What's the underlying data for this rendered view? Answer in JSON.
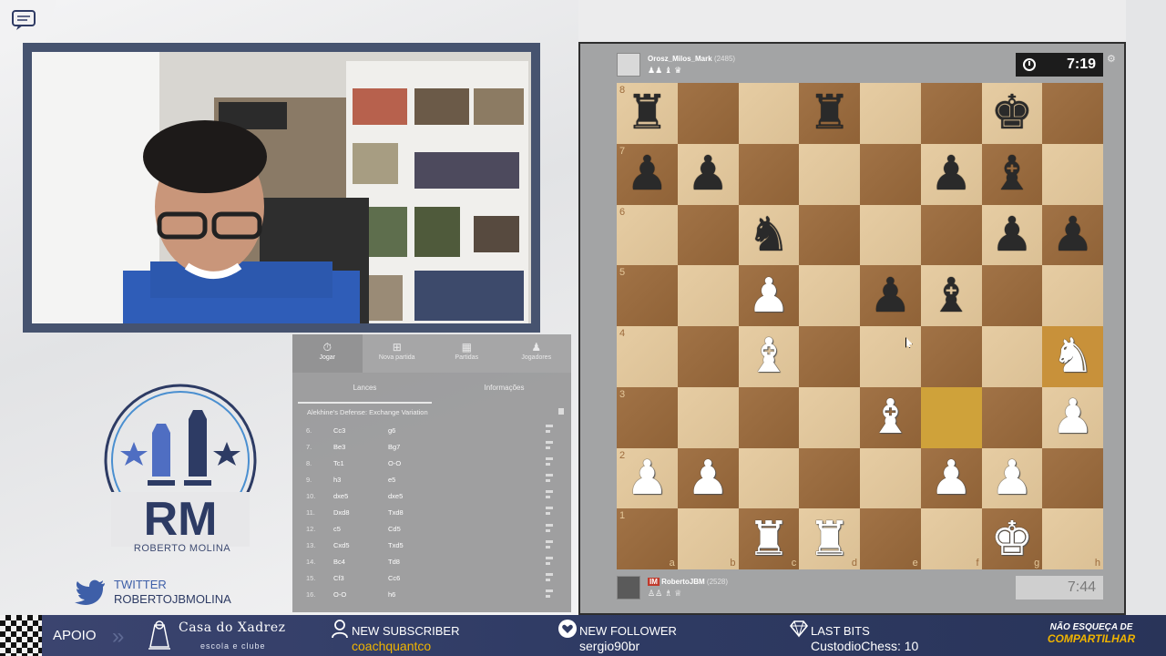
{
  "stream": {
    "twitter_label": "TWITTER",
    "twitter_handle": "ROBERTOJBMOLINA",
    "logo_letters": "RM",
    "logo_name": "ROBERTO MOLINA"
  },
  "lichess_panel": {
    "tabs": [
      {
        "label": "Jogar",
        "icon": "timer-icon",
        "active": true
      },
      {
        "label": "Nova partida",
        "icon": "plus-icon",
        "active": false
      },
      {
        "label": "Partidas",
        "icon": "grid-icon",
        "active": false
      },
      {
        "label": "Jogadores",
        "icon": "players-icon",
        "active": false
      }
    ],
    "subtabs": [
      {
        "label": "Lances",
        "active": true
      },
      {
        "label": "Informações",
        "active": false
      }
    ],
    "opening": "Alekhine's Defense: Exchange Variation",
    "moves": [
      {
        "num": "6.",
        "white": "Cc3",
        "black": "g6"
      },
      {
        "num": "7.",
        "white": "Be3",
        "black": "Bg7"
      },
      {
        "num": "8.",
        "white": "Tc1",
        "black": "O-O"
      },
      {
        "num": "9.",
        "white": "h3",
        "black": "e5"
      },
      {
        "num": "10.",
        "white": "dxe5",
        "black": "dxe5"
      },
      {
        "num": "11.",
        "white": "Dxd8",
        "black": "Txd8"
      },
      {
        "num": "12.",
        "white": "c5",
        "black": "Cd5"
      },
      {
        "num": "13.",
        "white": "Cxd5",
        "black": "Txd5"
      },
      {
        "num": "14.",
        "white": "Bc4",
        "black": "Td8"
      },
      {
        "num": "15.",
        "white": "Cf3",
        "black": "Cc6"
      },
      {
        "num": "16.",
        "white": "O-O",
        "black": "h6"
      }
    ]
  },
  "top_player": {
    "name": "Orosz_Milos_Mark",
    "rating": "(2485)",
    "clock": "7:19"
  },
  "bottom_player": {
    "title": "IM",
    "name": "RobertoJBM",
    "rating": "(2528)",
    "clock": "7:44"
  },
  "board": {
    "files": [
      "a",
      "b",
      "c",
      "d",
      "e",
      "f",
      "g",
      "h"
    ],
    "ranks": [
      "8",
      "7",
      "6",
      "5",
      "4",
      "3",
      "2",
      "1"
    ],
    "position": [
      [
        "bR",
        "",
        "",
        "bR",
        "",
        "",
        "bK",
        ""
      ],
      [
        "bP",
        "bP",
        "",
        "",
        "",
        "bP",
        "bB",
        ""
      ],
      [
        "",
        "",
        "bN",
        "",
        "",
        "",
        "bP",
        "bP"
      ],
      [
        "",
        "",
        "wP",
        "",
        "bP",
        "bB",
        "",
        ""
      ],
      [
        "",
        "",
        "wB",
        "",
        "",
        "",
        "",
        "wN"
      ],
      [
        "",
        "",
        "",
        "",
        "wB",
        "",
        "",
        "wP"
      ],
      [
        "wP",
        "wP",
        "",
        "",
        "",
        "wP",
        "wP",
        ""
      ],
      [
        "",
        "",
        "wR",
        "wR",
        "",
        "",
        "wK",
        ""
      ]
    ],
    "highlights": [
      "f3",
      "h4"
    ]
  },
  "bottom_bar": {
    "apoio": "APOIO",
    "sponsor_title": "Casa do Xadrez",
    "sponsor_sub": "escola e clube",
    "alerts": [
      {
        "label": "NEW SUBSCRIBER",
        "value": "coachquantco",
        "icon": "subscriber-icon"
      },
      {
        "label": "NEW FOLLOWER",
        "value": "sergio90br",
        "icon": "heart-icon"
      },
      {
        "label": "LAST BITS",
        "value": "CustodioChess: 10",
        "icon": "diamond-icon"
      }
    ],
    "share_line1": "NÃO ESQUEÇA DE",
    "share_line2": "COMPARTILHAR"
  }
}
